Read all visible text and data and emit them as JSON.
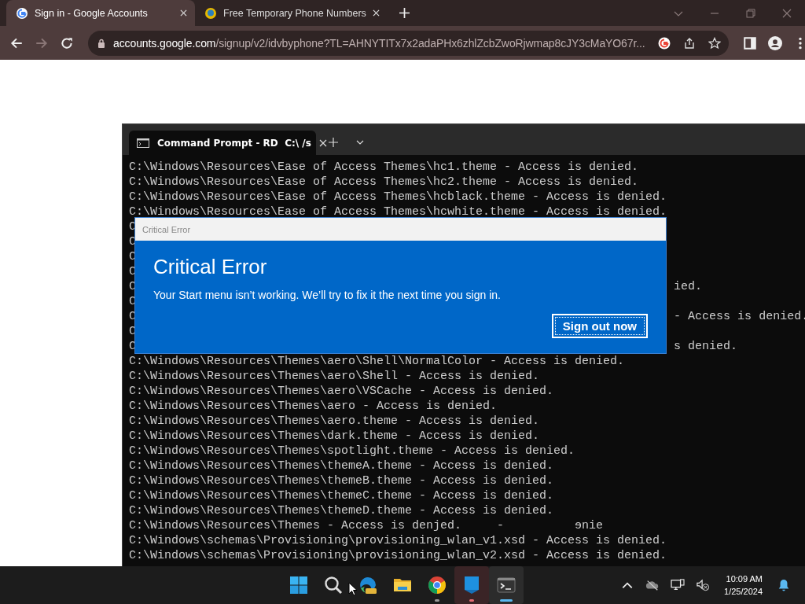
{
  "browser": {
    "tabs": [
      {
        "title": "Sign in - Google Accounts",
        "selected": true
      },
      {
        "title": "Free Temporary Phone Numbers",
        "selected": false
      }
    ],
    "forward": {
      "disabled": true
    },
    "address": {
      "host": "accounts.google.com",
      "path": "/signup/v2/idvbyphone?TL=AHNYTITx7x2adaPHx6zhlZcbZwoRjwmap8cJY3cMaYO67r..."
    }
  },
  "terminal": {
    "tab_title": "Command Prompt - RD  C:\\ /s",
    "lines": [
      {
        "text": "C:\\Windows\\Resources\\Ease of Access Themes\\hc1.theme - Access is denied."
      },
      {
        "text": "C:\\Windows\\Resources\\Ease of Access Themes\\hc2.theme - Access is denied."
      },
      {
        "text": "C:\\Windows\\Resources\\Ease of Access Themes\\hcblack.theme - Access is denied."
      },
      {
        "text": "C:\\Windows\\Resources\\Ease of Access Themes\\hcwhite.theme - Access is denied."
      },
      {
        "text": "C"
      },
      {
        "text": "C"
      },
      {
        "text": "C"
      },
      {
        "text": "C"
      },
      {
        "text": "C",
        "tail": "ied."
      },
      {
        "text": "C"
      },
      {
        "text": "C",
        "tail": "- Access is denied."
      },
      {
        "text": "C"
      },
      {
        "text": "C",
        "tail": "s denied."
      },
      {
        "text": "C:\\Windows\\Resources\\Themes\\aero\\Shell\\NormalColor - Access is denied."
      },
      {
        "text": "C:\\Windows\\Resources\\Themes\\aero\\Shell - Access is denied."
      },
      {
        "text": "C:\\Windows\\Resources\\Themes\\aero\\VSCache - Access is denied."
      },
      {
        "text": "C:\\Windows\\Resources\\Themes\\aero - Access is denied."
      },
      {
        "text": "C:\\Windows\\Resources\\Themes\\aero.theme - Access is denied."
      },
      {
        "text": "C:\\Windows\\Resources\\Themes\\dark.theme - Access is denied."
      },
      {
        "text": "C:\\Windows\\Resources\\Themes\\spotlight.theme - Access is denied."
      },
      {
        "text": "C:\\Windows\\Resources\\Themes\\themeA.theme - Access is denied."
      },
      {
        "text": "C:\\Windows\\Resources\\Themes\\themeB.theme - Access is denied."
      },
      {
        "text": "C:\\Windows\\Resources\\Themes\\themeC.theme - Access is denied."
      },
      {
        "text": "C:\\Windows\\Resources\\Themes\\themeD.theme - Access is denied."
      },
      {
        "text": "C:\\Windows\\Resources\\Themes - Access is denjed.     -          ɘnie"
      },
      {
        "text": "C:\\Windows\\schemas\\Provisioning\\provisioning_wlan_v1.xsd - Access is denied."
      },
      {
        "text": "C:\\Windows\\schemas\\Provisioning\\provisioning_wlan_v2.xsd - Access is denied."
      }
    ]
  },
  "dialog": {
    "caption": "Critical Error",
    "heading": "Critical Error",
    "message": "Your Start menu isn’t working. We’ll try to fix it the next time you sign in.",
    "button": "Sign out now"
  },
  "taskbar": {
    "apps": [
      {
        "kind": "start",
        "running": false,
        "active": false,
        "flashing": false
      },
      {
        "kind": "search",
        "running": false,
        "active": false,
        "flashing": false
      },
      {
        "kind": "edge",
        "running": false,
        "active": false,
        "flashing": false
      },
      {
        "kind": "files",
        "running": false,
        "active": false,
        "flashing": false
      },
      {
        "kind": "chrome",
        "running": true,
        "active": false,
        "flashing": false,
        "color": "#9a9a9a"
      },
      {
        "kind": "app",
        "running": true,
        "active": false,
        "flashing": true,
        "color": "#e46c74"
      },
      {
        "kind": "terminal",
        "running": true,
        "active": true,
        "flashing": false,
        "color": "#5ab8f0"
      }
    ],
    "time": "10:09 AM",
    "date": "1/25/2024"
  }
}
